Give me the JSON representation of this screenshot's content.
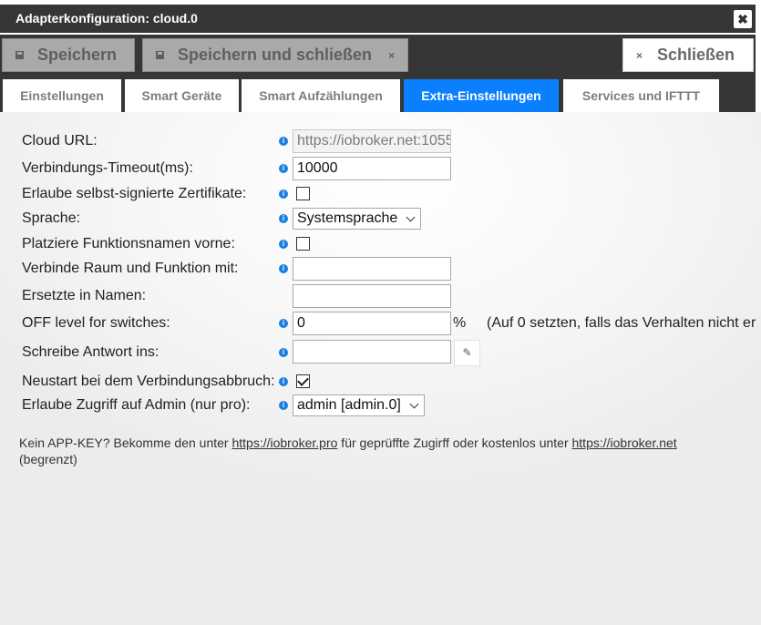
{
  "window": {
    "title": "Adapterkonfiguration: cloud.0",
    "close_glyph": "✖"
  },
  "toolbar": {
    "save_label": "Speichern",
    "save_close_label": "Speichern und schließen",
    "save_close_x": "×",
    "close_label": "Schließen",
    "close_x": "×"
  },
  "tabs": [
    {
      "label": "Einstellungen",
      "active": false
    },
    {
      "label": "Smart Geräte",
      "active": false
    },
    {
      "label": "Smart Aufzählungen",
      "active": false
    },
    {
      "label": "Extra-Einstellungen",
      "active": true
    },
    {
      "label": "Services und IFTTT",
      "active": false
    }
  ],
  "form": {
    "cloud_url": {
      "label": "Cloud URL:",
      "value": "https://iobroker.net:1055"
    },
    "timeout": {
      "label": "Verbindungs-Timeout(ms):",
      "value": "10000"
    },
    "self_signed": {
      "label": "Erlaube selbst-signierte Zertifikate:",
      "checked": false
    },
    "language": {
      "label": "Sprache:",
      "value": "Systemsprache"
    },
    "func_first": {
      "label": "Platziere Funktionsnamen vorne:",
      "checked": false
    },
    "concat_word": {
      "label": "Verbinde Raum und Funktion mit:",
      "value": ""
    },
    "replaces": {
      "label": "Ersetzte in Namen:",
      "value": ""
    },
    "off_level": {
      "label": "OFF level for switches:",
      "value": "0",
      "suffix": "%",
      "hint": "(Auf 0 setzten, falls das Verhalten nicht er"
    },
    "response_oid": {
      "label": "Schreibe Antwort ins:",
      "value": ""
    },
    "restart_on_disconnect": {
      "label": "Neustart bei dem Verbindungsabbruch:",
      "checked": true
    },
    "allow_admin": {
      "label": "Erlaube Zugriff auf Admin (nur pro):",
      "value": "admin [admin.0]"
    }
  },
  "footer": {
    "text1": "Kein APP-KEY? Bekomme den unter ",
    "link1": "https://iobroker.pro",
    "text2": " für geprüffte Zugirff oder kostenlos unter ",
    "link2": "https://iobroker.net",
    "text3": "(begrenzt)"
  },
  "icons": {
    "info": "info-icon",
    "pencil": "pencil-icon",
    "disk": "disk-icon"
  },
  "colors": {
    "accent": "#0a80ff",
    "dark_bar": "#363636",
    "info_blue": "#1a7ee0"
  }
}
